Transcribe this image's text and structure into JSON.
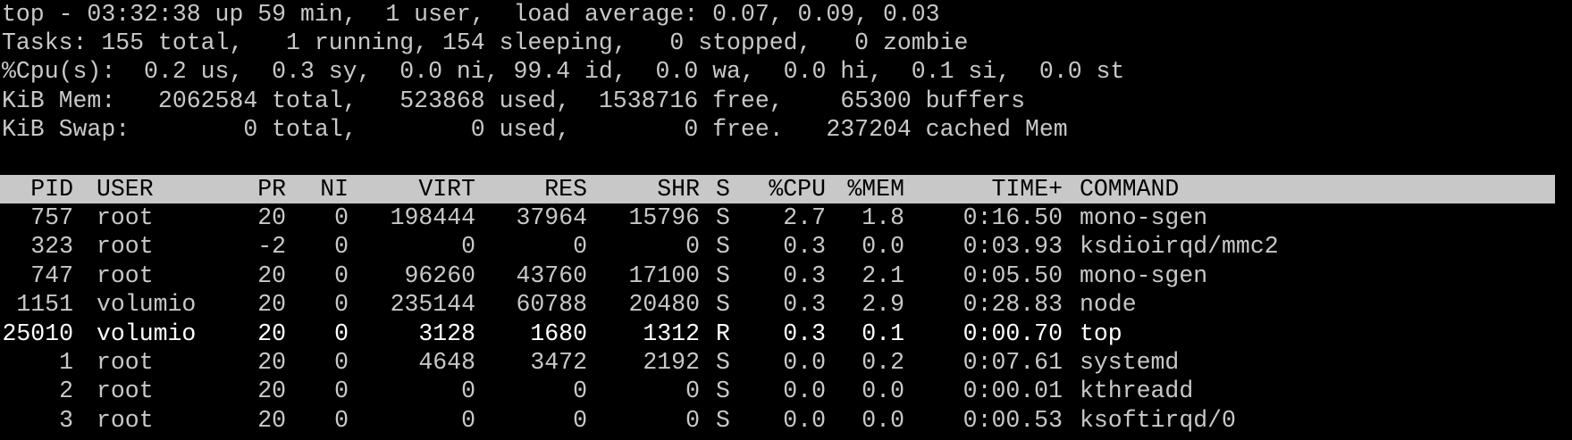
{
  "summary": {
    "uptime_line": "top - 03:32:38 up 59 min,  1 user,  load average: 0.07, 0.09, 0.03",
    "tasks_line": "Tasks: 155 total,   1 running, 154 sleeping,   0 stopped,   0 zombie",
    "cpu_line": "%Cpu(s):  0.2 us,  0.3 sy,  0.0 ni, 99.4 id,  0.0 wa,  0.0 hi,  0.1 si,  0.0 st",
    "mem_line": "KiB Mem:   2062584 total,   523868 used,  1538716 free,    65300 buffers",
    "swap_line": "KiB Swap:        0 total,        0 used,        0 free.   237204 cached Mem"
  },
  "table": {
    "columns": [
      "PID",
      "USER",
      "PR",
      "NI",
      "VIRT",
      "RES",
      "SHR",
      "S",
      "%CPU",
      "%MEM",
      "TIME+",
      "COMMAND"
    ],
    "rows": [
      [
        "757",
        "root",
        "20",
        "0",
        "198444",
        "37964",
        "15796",
        "S",
        "2.7",
        "1.8",
        "0:16.50",
        "mono-sgen"
      ],
      [
        "323",
        "root",
        "-2",
        "0",
        "0",
        "0",
        "0",
        "S",
        "0.3",
        "0.0",
        "0:03.93",
        "ksdioirqd/mmc2"
      ],
      [
        "747",
        "root",
        "20",
        "0",
        "96260",
        "43760",
        "17100",
        "S",
        "0.3",
        "2.1",
        "0:05.50",
        "mono-sgen"
      ],
      [
        "1151",
        "volumio",
        "20",
        "0",
        "235144",
        "60788",
        "20480",
        "S",
        "0.3",
        "2.9",
        "0:28.83",
        "node"
      ],
      [
        "25010",
        "volumio",
        "20",
        "0",
        "3128",
        "1680",
        "1312",
        "R",
        "0.3",
        "0.1",
        "0:00.70",
        "top"
      ],
      [
        "1",
        "root",
        "20",
        "0",
        "4648",
        "3472",
        "2192",
        "S",
        "0.0",
        "0.2",
        "0:07.61",
        "systemd"
      ],
      [
        "2",
        "root",
        "20",
        "0",
        "0",
        "0",
        "0",
        "S",
        "0.0",
        "0.0",
        "0:00.01",
        "kthreadd"
      ],
      [
        "3",
        "root",
        "20",
        "0",
        "0",
        "0",
        "0",
        "S",
        "0.0",
        "0.0",
        "0:00.53",
        "ksoftirqd/0"
      ]
    ],
    "highlighted_row": 4
  },
  "colors": {
    "background": "#000000",
    "text": "#c8c8c8",
    "header_bar": "#c8c8c8",
    "highlight_text": "#ffffff"
  }
}
